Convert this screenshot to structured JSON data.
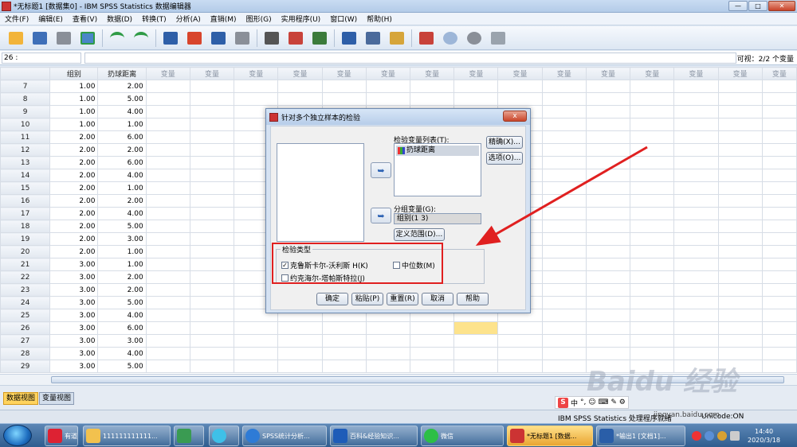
{
  "window": {
    "title": "*无标题1 [数据集0] - IBM SPSS Statistics 数据编辑器",
    "minimize": "—",
    "maximize": "□",
    "close": "✕"
  },
  "menu": [
    "文件(F)",
    "编辑(E)",
    "查看(V)",
    "数据(D)",
    "转换(T)",
    "分析(A)",
    "直销(M)",
    "图形(G)",
    "实用程序(U)",
    "窗口(W)",
    "帮助(H)"
  ],
  "toolbar_icons": [
    "open-folder-icon",
    "save-icon",
    "print-icon",
    "dialog-recall-icon",
    "undo-icon",
    "redo-icon",
    "goto-case-icon",
    "goto-variable-icon",
    "variables-icon",
    "split-icon",
    "find-icon",
    "insert-cases-icon",
    "insert-variable-icon",
    "split-file-icon",
    "weight-cases-icon",
    "select-cases-icon",
    "value-labels-icon",
    "use-sets-icon",
    "show-all-icon",
    "spell-check-icon"
  ],
  "cellbar": {
    "ref": "26 :",
    "visible": "可视：2/2 个变量"
  },
  "grid": {
    "headers": [
      "组别",
      "扔球距离",
      "变量",
      "变量",
      "变量",
      "变量",
      "变量",
      "变量",
      "变量",
      "变量",
      "变量",
      "变量",
      "变量",
      "变量",
      "变量",
      "变量",
      "变量"
    ],
    "rows": [
      [
        "7",
        "1.00",
        "2.00"
      ],
      [
        "8",
        "1.00",
        "5.00"
      ],
      [
        "9",
        "1.00",
        "4.00"
      ],
      [
        "10",
        "1.00",
        "1.00"
      ],
      [
        "11",
        "2.00",
        "6.00"
      ],
      [
        "12",
        "2.00",
        "2.00"
      ],
      [
        "13",
        "2.00",
        "6.00"
      ],
      [
        "14",
        "2.00",
        "4.00"
      ],
      [
        "15",
        "2.00",
        "1.00"
      ],
      [
        "16",
        "2.00",
        "2.00"
      ],
      [
        "17",
        "2.00",
        "4.00"
      ],
      [
        "18",
        "2.00",
        "5.00"
      ],
      [
        "19",
        "2.00",
        "3.00"
      ],
      [
        "20",
        "2.00",
        "1.00"
      ],
      [
        "21",
        "3.00",
        "1.00"
      ],
      [
        "22",
        "3.00",
        "2.00"
      ],
      [
        "23",
        "3.00",
        "2.00"
      ],
      [
        "24",
        "3.00",
        "5.00"
      ],
      [
        "25",
        "3.00",
        "4.00"
      ],
      [
        "26",
        "3.00",
        "6.00"
      ],
      [
        "27",
        "3.00",
        "3.00"
      ],
      [
        "28",
        "3.00",
        "4.00"
      ],
      [
        "29",
        "3.00",
        "5.00"
      ]
    ]
  },
  "view_tabs": {
    "data": "数据视图",
    "variable": "变量视图"
  },
  "status": {
    "ready": "IBM SPSS Statistics 处理程序就绪",
    "unicode": "Unicode:ON"
  },
  "ime": {
    "logo": "S",
    "lang": "中",
    "icons": "°, ☺ ⌨ ✎ ⚙"
  },
  "watermark": {
    "text": "Baidu 经验",
    "sub": "jingyan.baidu.com"
  },
  "dialog": {
    "title": "针对多个独立样本的检验",
    "close": "x",
    "test_list_label": "检验变量列表(T):",
    "test_var": "扔球距离",
    "group_label": "分组变量(G):",
    "group_value": "组别(1 3)",
    "define_range": "定义范围(D)...",
    "exact": "精确(X)...",
    "options": "选项(O)...",
    "test_type": "检验类型",
    "kw": "克鲁斯卡尔-沃利斯 H(K)",
    "kw_checked": "✓",
    "median": "中位数(M)",
    "jt": "约克海尔-塔帕斯特拉(J)",
    "ok": "确定",
    "paste": "粘贴(P)",
    "reset": "重置(R)",
    "cancel": "取消",
    "help": "帮助",
    "arrow": "➥"
  },
  "taskbar": {
    "items": [
      "有道",
      "111111111111...",
      "",
      "",
      "SPSS统计分析...",
      "百科&经验知识...",
      "微信",
      "*无标题1 [数据...",
      "*输出1 [文档1]..."
    ],
    "time": "14:40",
    "date": "2020/3/18"
  },
  "colors": {
    "highlight_cell": "#fde38c",
    "annotation_red": "#e02020",
    "active_tab": "#ffd35e"
  }
}
